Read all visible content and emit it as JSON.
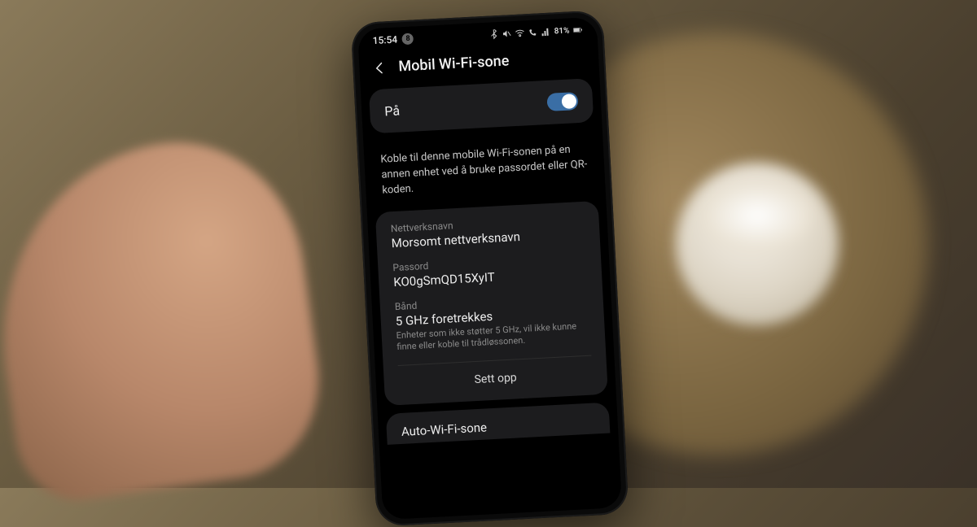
{
  "statusbar": {
    "time": "15:54",
    "notif_count": "8",
    "battery_text": "81%"
  },
  "header": {
    "title": "Mobil Wi-Fi-sone"
  },
  "toggle": {
    "label": "På",
    "state": "on"
  },
  "description": "Koble til denne mobile Wi-Fi-sonen på en annen enhet ved å bruke passordet eller QR-koden.",
  "network": {
    "name_label": "Nettverksnavn",
    "name_value": "Morsomt nettverksnavn",
    "password_label": "Passord",
    "password_value": "KO0gSmQD15XyIT",
    "band_label": "Bånd",
    "band_value": "5 GHz foretrekkes",
    "band_hint": "Enheter som ikke støtter 5 GHz, vil ikke kunne finne eller koble til trådløssonen."
  },
  "setup_button": "Sett opp",
  "auto_section": {
    "title": "Auto-Wi-Fi-sone"
  }
}
